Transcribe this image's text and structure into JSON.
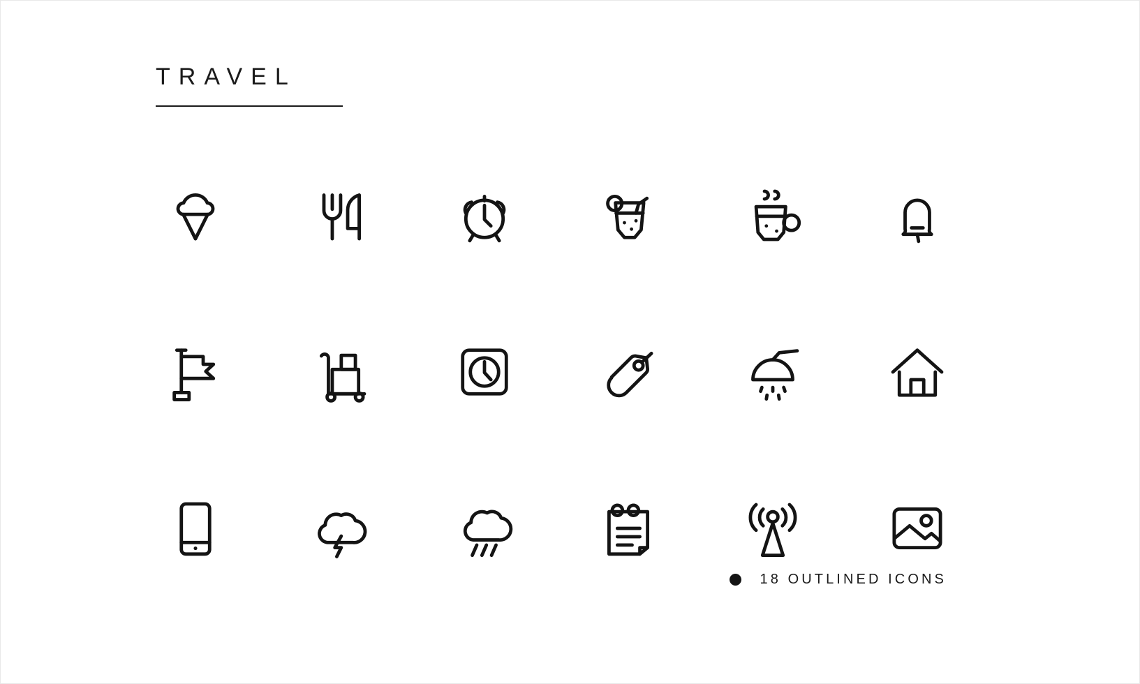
{
  "page": {
    "title": "TRAVEL",
    "background_color": "#ffffff",
    "ink_color": "#141414"
  },
  "footer": {
    "bullet": "bullet-dot",
    "text": "18 OUTLINED ICONS"
  },
  "icons": [
    {
      "name": "ice-cream-cone-icon",
      "label": "Ice Cream Cone",
      "row": 1,
      "col": 1
    },
    {
      "name": "fork-and-knife-icon",
      "label": "Fork And Knife",
      "row": 1,
      "col": 2
    },
    {
      "name": "alarm-clock-icon",
      "label": "Alarm Clock",
      "row": 1,
      "col": 3
    },
    {
      "name": "cocktail-drink-icon",
      "label": "Cocktail Drink",
      "row": 1,
      "col": 4
    },
    {
      "name": "hot-mug-icon",
      "label": "Hot Mug",
      "row": 1,
      "col": 5
    },
    {
      "name": "bell-icon",
      "label": "Bell",
      "row": 1,
      "col": 6
    },
    {
      "name": "flag-icon",
      "label": "Flag",
      "row": 2,
      "col": 1
    },
    {
      "name": "luggage-trolley-icon",
      "label": "Luggage Trolley",
      "row": 2,
      "col": 2
    },
    {
      "name": "square-clock-icon",
      "label": "Square Clock",
      "row": 2,
      "col": 3
    },
    {
      "name": "luggage-tag-icon",
      "label": "Luggage Tag",
      "row": 2,
      "col": 4
    },
    {
      "name": "shower-head-icon",
      "label": "Shower Head",
      "row": 2,
      "col": 5
    },
    {
      "name": "house-icon",
      "label": "House",
      "row": 2,
      "col": 6
    },
    {
      "name": "smartphone-icon",
      "label": "Smartphone",
      "row": 3,
      "col": 1
    },
    {
      "name": "thunderstorm-cloud-icon",
      "label": "Thunderstorm Cloud",
      "row": 3,
      "col": 2
    },
    {
      "name": "rain-cloud-icon",
      "label": "Rain Cloud",
      "row": 3,
      "col": 3
    },
    {
      "name": "notepad-icon",
      "label": "Notepad",
      "row": 3,
      "col": 4
    },
    {
      "name": "radio-tower-icon",
      "label": "Radio Tower",
      "row": 3,
      "col": 5
    },
    {
      "name": "image-photo-icon",
      "label": "Image Photo",
      "row": 3,
      "col": 6
    }
  ]
}
